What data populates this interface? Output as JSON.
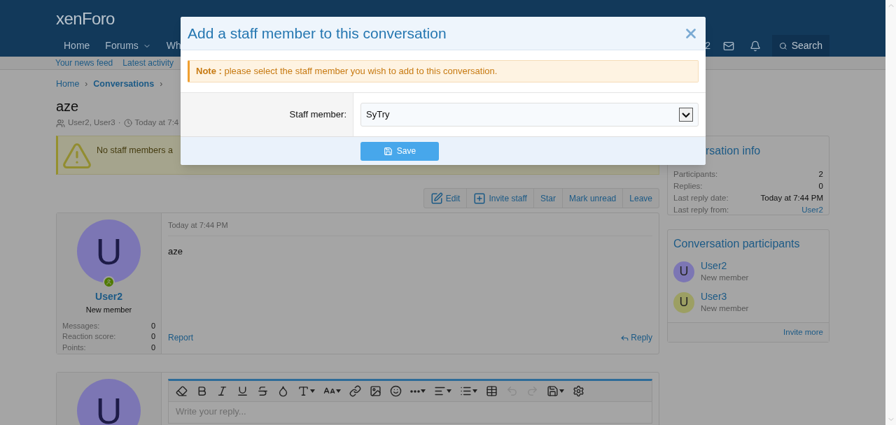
{
  "header": {
    "logo": "xenForo",
    "nav": [
      {
        "label": "Home",
        "caret": false
      },
      {
        "label": "Forums",
        "caret": true
      },
      {
        "label": "Wh",
        "caret": false
      }
    ],
    "user_label": "2",
    "search": "Search"
  },
  "subnav": [
    "Your news feed",
    "Latest activity"
  ],
  "breadcrumb": [
    {
      "label": "Home",
      "separator": "›"
    },
    {
      "label": "Conversations",
      "separator": "›"
    }
  ],
  "title": "aze",
  "meta": {
    "participants": "User2, User3",
    "separator": "·",
    "date": "Today at 7:4"
  },
  "alert": "No staff members a",
  "actions": [
    {
      "label": "Edit",
      "kind": "edit"
    },
    {
      "label": "Invite staff",
      "kind": "add"
    },
    {
      "label": "Star",
      "kind": "text"
    },
    {
      "label": "Mark unread",
      "kind": "text"
    },
    {
      "label": "Leave",
      "kind": "text"
    }
  ],
  "post": {
    "avatar_letter": "U",
    "color": "#7c76b4",
    "online": true,
    "username": "User2",
    "role": "New member",
    "stats": [
      {
        "label": "Messages:",
        "value": "0"
      },
      {
        "label": "Reaction score:",
        "value": "0"
      },
      {
        "label": "Points:",
        "value": "0"
      }
    ],
    "date": "Today at 7:44 PM",
    "body": "aze",
    "report": "Report",
    "reply": "Reply"
  },
  "sidebar": {
    "info": {
      "title": "rsation info",
      "rows": [
        {
          "label": "Participants:",
          "value": "2",
          "link": false
        },
        {
          "label": "Replies:",
          "value": "0",
          "link": false
        },
        {
          "label": "Last reply date:",
          "value": "Today at 7:44 PM",
          "link": false
        },
        {
          "label": "Last reply from:",
          "value": "User2",
          "link": true
        }
      ]
    },
    "participants": {
      "title": "Conversation participants",
      "items": [
        {
          "letter": "U",
          "name": "User2",
          "role": "New member",
          "color": "#7c76b4"
        },
        {
          "letter": "U",
          "name": "User3",
          "role": "New member",
          "color": "#9c9f63"
        }
      ],
      "footer": "Invite more"
    }
  },
  "reply_box": {
    "avatar_letter": "U",
    "color": "#7c76b4",
    "toolbar": [
      {
        "kind": "eraser",
        "menu": false,
        "disabled": false
      },
      {
        "kind": "bold",
        "menu": false,
        "disabled": false
      },
      {
        "kind": "italic",
        "menu": false,
        "disabled": false
      },
      {
        "kind": "underline",
        "menu": false,
        "disabled": false
      },
      {
        "kind": "strike",
        "menu": false,
        "disabled": false
      },
      {
        "kind": "color",
        "menu": false,
        "disabled": false
      },
      {
        "kind": "font",
        "menu": true,
        "disabled": false
      },
      {
        "kind": "size",
        "menu": true,
        "disabled": false
      },
      {
        "kind": "link",
        "menu": false,
        "disabled": false
      },
      {
        "kind": "image",
        "menu": false,
        "disabled": false
      },
      {
        "kind": "smilie",
        "menu": false,
        "disabled": false
      },
      {
        "kind": "more",
        "menu": true,
        "disabled": false
      },
      {
        "kind": "align",
        "menu": true,
        "disabled": false
      },
      {
        "kind": "list",
        "menu": true,
        "disabled": false
      },
      {
        "kind": "table",
        "menu": false,
        "disabled": false
      },
      {
        "kind": "undo",
        "menu": false,
        "disabled": true
      },
      {
        "kind": "redo",
        "menu": false,
        "disabled": true
      },
      {
        "kind": "draft",
        "menu": true,
        "disabled": false
      },
      {
        "kind": "settings",
        "menu": false,
        "disabled": false
      }
    ],
    "placeholder": "Write your reply..."
  },
  "modal": {
    "title": "Add a staff member to this conversation",
    "note_label": "Note :",
    "note": "please select the staff member you wish to add to this conversation.",
    "field_label": "Staff member:",
    "field_value": "SyTry",
    "save": "Save"
  }
}
